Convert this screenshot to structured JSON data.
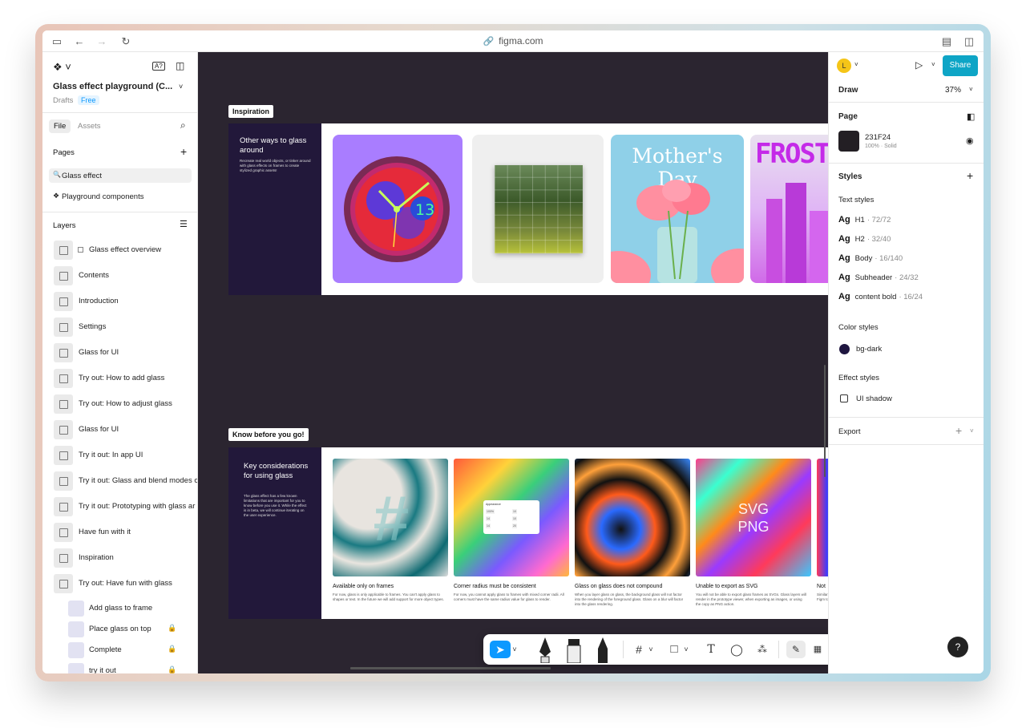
{
  "browser": {
    "url": "figma.com"
  },
  "file": {
    "title": "Glass effect playground (C...",
    "location": "Drafts",
    "plan_badge": "Free",
    "tabs": [
      "File",
      "Assets"
    ]
  },
  "pages": {
    "heading": "Pages",
    "items": [
      "Glass effect",
      "Playground components"
    ]
  },
  "layers": {
    "heading": "Layers",
    "items": [
      "Glass effect overview",
      "Contents",
      "Introduction",
      "Settings",
      "Glass for UI",
      "Try out: How to add glass",
      "Try out: How to adjust glass",
      "Glass for UI",
      "Try it out: In app UI",
      "Try it out: Glass and blend modes c",
      "Try it out: Prototyping with glass ar",
      "Have fun with it",
      "Inspiration",
      "Try out: Have fun with glass"
    ],
    "children": [
      "Add glass to frame",
      "Place glass on top",
      "Complete",
      "try it out"
    ]
  },
  "canvas": {
    "section1": {
      "tag": "Inspiration",
      "title": "Other ways to glass around",
      "desc": "Recreate real world objects, or tinker around with glass effects on frames to create stylized graphic assets!",
      "card3_text": "Mother's Day",
      "card4_text": "FROSTC",
      "clock_number": "13"
    },
    "section2": {
      "tag": "Know before you go!",
      "title": "Key considerations for using glass",
      "desc": "The glass effect has a few known limitations that are important for you to know before you use it. While the effect is in beta, we will continue iterating on the user experience.",
      "cards": [
        {
          "title": "Available only on frames",
          "desc": "For now, glass is only applicable to frames. You can't apply glass to shapes or text. In the future we will add support for more object types."
        },
        {
          "title": "Corner radius must be consistent",
          "desc": "For now, you cannot apply glass to frames with mixed corner radii. All corners must have the same radius value for glass to render."
        },
        {
          "title": "Glass on glass does not compound",
          "desc": "When you layer glass on glass, the background glass will not factor into the rendering of the foreground glass. Glass on a blur will factor into the glass rendering."
        },
        {
          "title": "Unable to export as SVG",
          "desc": "You will not be able to export glass frames as SVGs. Glass layers will render in the prototype viewer, when exporting as images, or using the copy as PNG action."
        },
        {
          "title": "Not",
          "desc": "Similar in Figm to dete"
        }
      ],
      "svg_png": [
        "SVG",
        "PNG"
      ],
      "mini_panel": {
        "title": "Appearance",
        "values": [
          "100%",
          "10",
          "14",
          "10",
          "14",
          "20"
        ]
      }
    }
  },
  "right": {
    "avatar": "L",
    "share": "Share",
    "draw": "Draw",
    "zoom": "37%",
    "page_heading": "Page",
    "page_color": "231F24",
    "page_opacity": "100% · Solid",
    "styles_heading": "Styles",
    "text_styles_heading": "Text styles",
    "text_styles": [
      {
        "ag": "Ag",
        "name": "H1",
        "size": "· 72/72"
      },
      {
        "ag": "Ag",
        "name": "H2",
        "size": "· 32/40"
      },
      {
        "ag": "Ag",
        "name": "Body",
        "size": "· 16/140"
      },
      {
        "ag": "Ag",
        "name": "Subheader",
        "size": "· 24/32"
      },
      {
        "ag": "Ag",
        "name": "content bold",
        "size": "· 16/24"
      }
    ],
    "color_styles_heading": "Color styles",
    "color_style": "bg-dark",
    "effect_styles_heading": "Effect styles",
    "effect_style": "UI shadow",
    "export": "Export",
    "help": "?"
  },
  "colors": {
    "accent": "#0d99ff",
    "share": "#0ea5c6",
    "canvas": "#2b2530",
    "bg_dark": "#1f1640"
  }
}
